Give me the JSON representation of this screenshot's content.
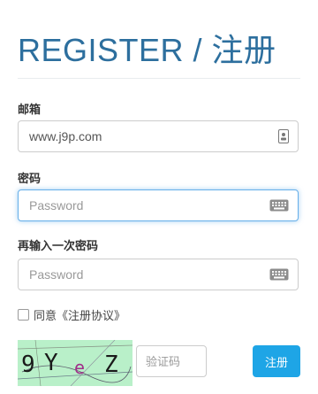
{
  "page": {
    "title": "REGISTER / 注册"
  },
  "form": {
    "email": {
      "label": "邮箱",
      "value": "www.j9p.com",
      "icon": "contact-card-icon"
    },
    "password": {
      "label": "密码",
      "placeholder": "Password",
      "icon": "keyboard-icon"
    },
    "confirm_password": {
      "label": "再输入一次密码",
      "placeholder": "Password",
      "icon": "keyboard-icon"
    },
    "agreement": {
      "label": "同意《注册协议》",
      "checked": false
    },
    "captcha": {
      "image_text": [
        "9",
        "Y",
        "e",
        "Z"
      ],
      "placeholder": "验证码"
    },
    "submit_label": "注册"
  },
  "colors": {
    "title": "#2d6f9e",
    "button": "#1ea5e6",
    "focus_border": "#66afe9",
    "captcha_bg": "#b9f0c9"
  }
}
